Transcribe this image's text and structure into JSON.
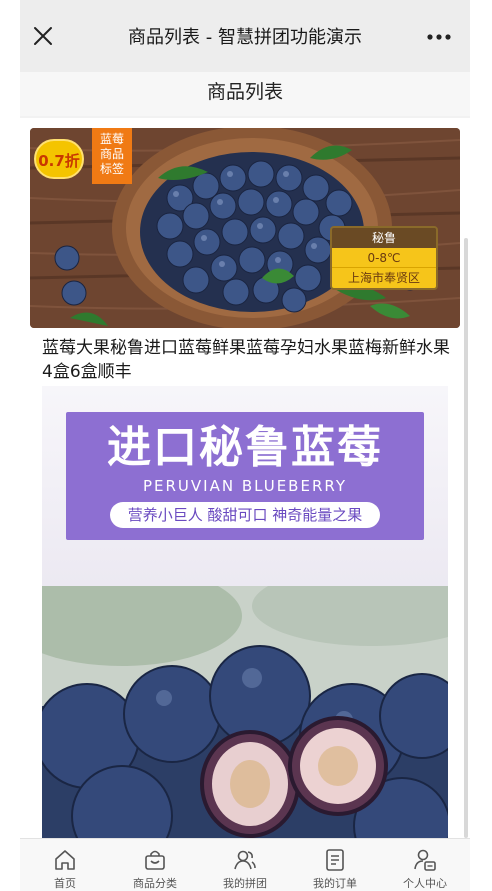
{
  "titlebar": {
    "title": "商品列表 - 智慧拼团功能演示",
    "close_icon": "close-icon",
    "more_icon": "more-icon"
  },
  "page": {
    "subtitle": "商品列表"
  },
  "product": {
    "discount": "0.7折",
    "tag_lines": [
      "蓝莓",
      "商品",
      "标签"
    ],
    "origin": {
      "country": "秘鲁",
      "temperature": "0-8℃",
      "place": "上海市奉贤区"
    },
    "title": "蓝莓大果秘鲁进口蓝莓鲜果蓝莓孕妇水果蓝梅新鲜水果4盒6盒顺丰"
  },
  "promo": {
    "headline": "进口秘鲁蓝莓",
    "english": "PERUVIAN BLUEBERRY",
    "slogan": "营养小巨人 酸甜可口 神奇能量之果"
  },
  "tabbar": {
    "items": [
      {
        "label": "首页",
        "icon": "home-icon"
      },
      {
        "label": "商品分类",
        "icon": "shopping-basket-icon"
      },
      {
        "label": "我的拼团",
        "icon": "group-users-icon"
      },
      {
        "label": "我的订单",
        "icon": "order-list-icon"
      },
      {
        "label": "个人中心",
        "icon": "user-center-icon"
      }
    ]
  },
  "colors": {
    "accent_orange": "#f07a14",
    "badge_yellow": "#f4c400",
    "promo_purple": "#8d6fd2"
  }
}
